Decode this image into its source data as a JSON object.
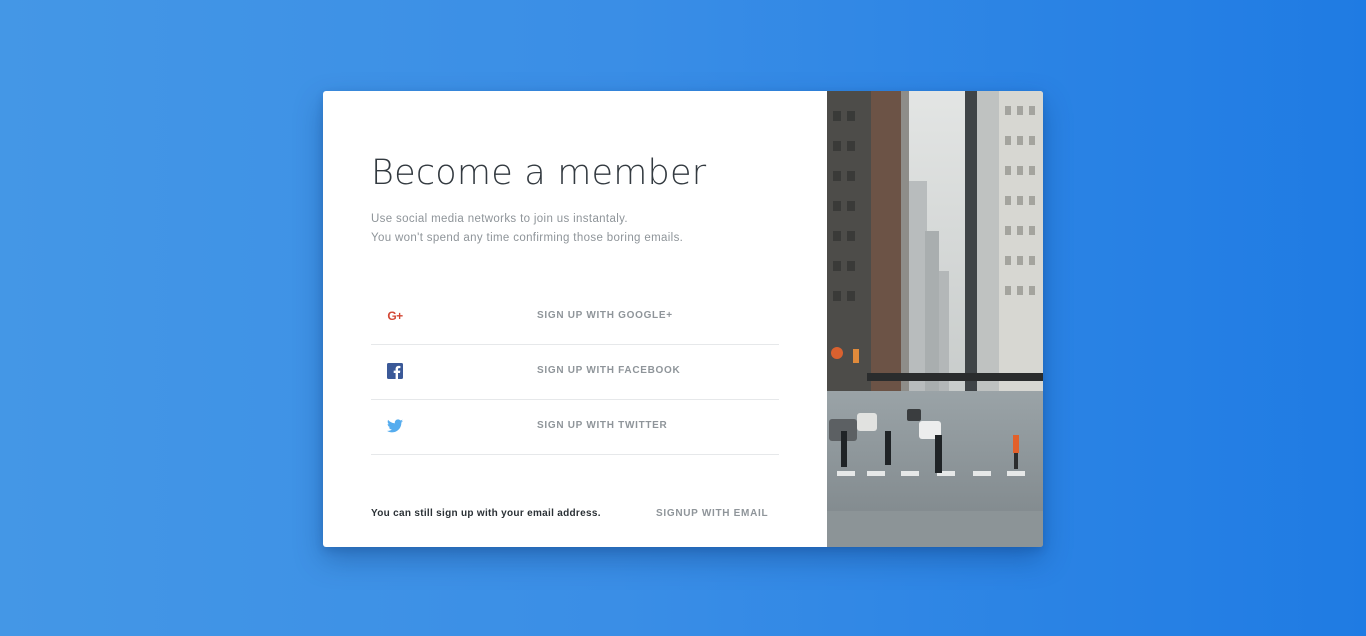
{
  "card": {
    "title": "Become a member",
    "subtitle_lines": [
      "Use social media networks to join us instantaly.",
      "You won't spend any time confirming those boring emails."
    ]
  },
  "social_buttons": [
    {
      "icon": "google-plus-icon",
      "glyph": "G+",
      "label": "SIGN UP WITH GOOGLE+",
      "color": "#d34836"
    },
    {
      "icon": "facebook-icon",
      "label": "SIGN UP WITH FACEBOOK",
      "color": "#3b5998"
    },
    {
      "icon": "twitter-icon",
      "label": "SIGN UP WITH TWITTER",
      "color": "#55acee"
    }
  ],
  "footer": {
    "text": "You can still sign up with your email address.",
    "email_link": "SIGNUP WITH EMAIL"
  },
  "colors": {
    "background_start": "#4497e6",
    "background_end": "#1f7be3",
    "title": "#333a40",
    "muted_text": "#8f959a"
  }
}
